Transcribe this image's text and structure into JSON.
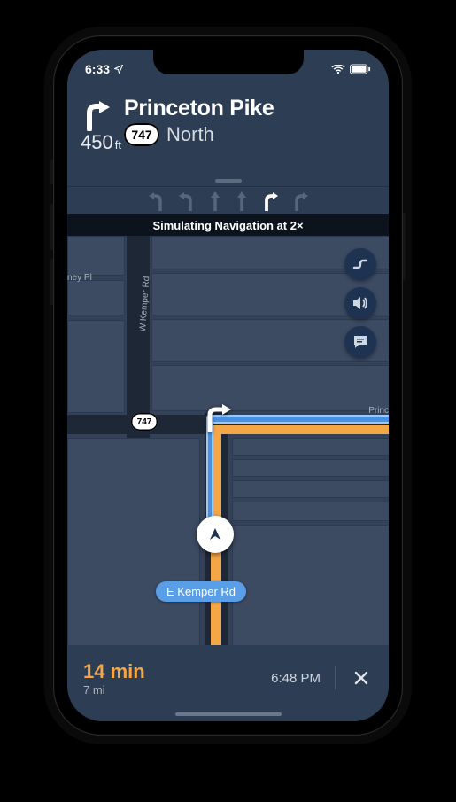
{
  "statusbar": {
    "time": "6:33"
  },
  "maneuver": {
    "primary": "Princeton Pike",
    "shield": "747",
    "direction": "North",
    "distance_value": "450",
    "distance_unit": "ft"
  },
  "simulation_banner": "Simulating Navigation at 2×",
  "map": {
    "streets": {
      "e_kemper": "E Kemper Rd",
      "w_kemper": "W Kemper Rd",
      "princeton": "Princ",
      "ney_pl": "ney Pl"
    },
    "shield": "747"
  },
  "bottom": {
    "duration": "14 min",
    "distance": "7 mi",
    "arrival": "6:48 PM"
  },
  "colors": {
    "accent_orange": "#f5a646",
    "accent_blue": "#4a90e2",
    "banner_bg": "#2c3d54",
    "map_bg": "#344259"
  }
}
